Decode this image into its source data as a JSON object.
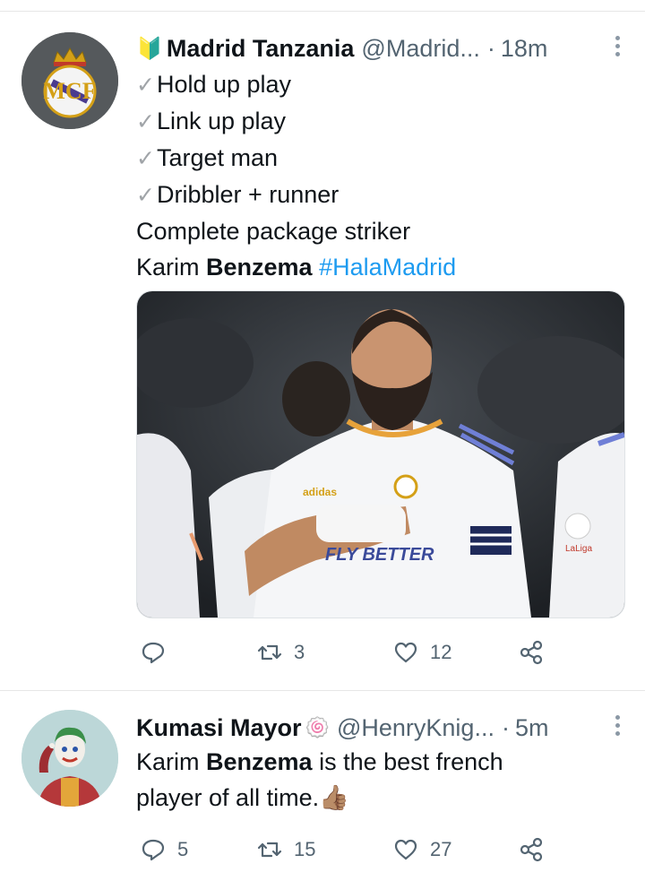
{
  "tweets": [
    {
      "display_name": "Madrid Tanzania",
      "name_emoji": "🔰",
      "handle": "@Madrid...",
      "separator": "·",
      "time": "18m",
      "checks": [
        "Hold up play",
        "Link up play",
        "Target man",
        "Dribbler + runner"
      ],
      "check_glyph": "✓",
      "line5": "Complete package striker",
      "line6_prefix": "Karim ",
      "line6_bold": "Benzema",
      "hashtag": "#HalaMadrid",
      "media_text": {
        "sponsor": "FLY BETTER",
        "brand": "adidas",
        "league": "LaLiga"
      },
      "actions": {
        "reply": "",
        "retweet": "3",
        "like": "12"
      }
    },
    {
      "display_name": "Kumasi Mayor",
      "name_emoji": "🍥",
      "handle": "@HenryKnig...",
      "separator": "·",
      "time": "5m",
      "text_prefix": "Karim ",
      "text_bold": "Benzema",
      "text_rest": " is the best french",
      "text_line2": "player of all time.",
      "text_emoji": "👍🏽",
      "actions": {
        "reply": "5",
        "retweet": "15",
        "like": "27"
      }
    }
  ],
  "icons": [
    "reply-icon",
    "retweet-icon",
    "like-icon",
    "share-icon",
    "more-icon"
  ],
  "colors": {
    "link": "#1d9bf0",
    "secondary": "#536471",
    "text": "#0f1419"
  }
}
